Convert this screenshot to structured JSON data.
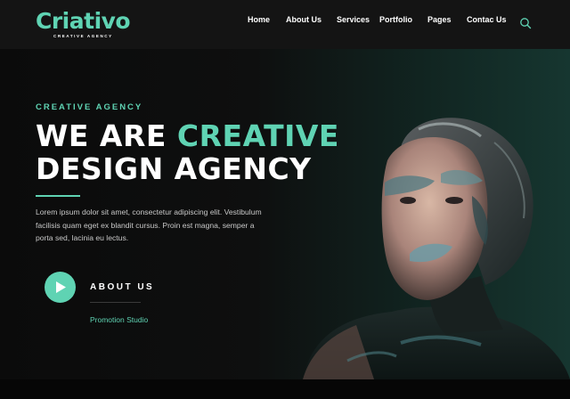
{
  "brand": {
    "name": "Criativo",
    "tagline": "CREATIVE AGENCY",
    "accent_color": "#5fd3b3"
  },
  "nav": {
    "items": [
      {
        "label": "Home"
      },
      {
        "label": "About Us"
      },
      {
        "label": "Services"
      },
      {
        "label": "Portfolio"
      },
      {
        "label": "Pages"
      },
      {
        "label": "Contac Us"
      }
    ],
    "search_icon": "search-icon"
  },
  "hero": {
    "eyebrow": "CREATIVE AGENCY",
    "headline_part1": "WE ARE ",
    "headline_accent": "CREATIVE",
    "headline_part2": "DESIGN AGENCY",
    "description": "Lorem ipsum dolor sit amet, consectetur adipiscing elit. Vestibulum facilisis quam eget ex blandit cursus. Proin est magna, semper a porta sed, lacinia eu lectus.",
    "play_icon": "play-icon",
    "about_label": "ABOUT US",
    "studio_link": "Promotion Studio"
  },
  "colors": {
    "background": "#0b0b0b",
    "header": "#141414",
    "accent": "#5fd3b3"
  }
}
